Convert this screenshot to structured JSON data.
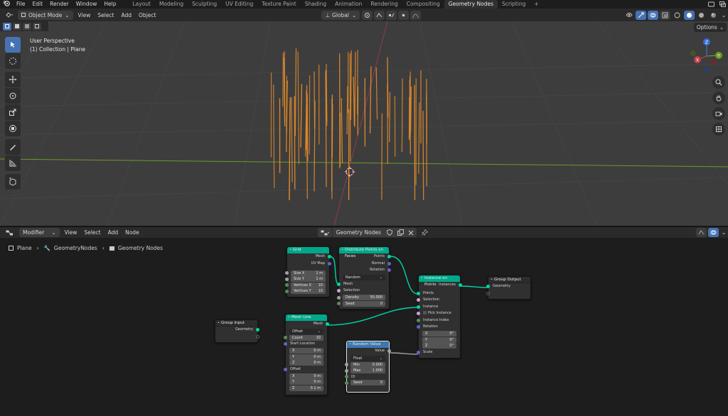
{
  "topbar": {
    "menu": [
      "File",
      "Edit",
      "Render",
      "Window",
      "Help"
    ],
    "workspaces": [
      "Layout",
      "Modeling",
      "Sculpting",
      "UV Editing",
      "Texture Paint",
      "Shading",
      "Animation",
      "Rendering",
      "Compositing",
      "Geometry Nodes",
      "Scripting"
    ],
    "active_workspace": "Geometry Nodes",
    "add_tab": "+"
  },
  "viewport_header": {
    "mode": "Object Mode",
    "menu": [
      "View",
      "Select",
      "Add",
      "Object"
    ],
    "transform_orientation": "Global"
  },
  "viewport": {
    "overlay_title": "User Perspective",
    "overlay_subtitle": "(1) Collection | Plane",
    "options_label": "Options",
    "gizmo": {
      "x": "X",
      "y": "Y",
      "z": "Z"
    }
  },
  "node_editor_header": {
    "context": "Modifier",
    "menu": [
      "View",
      "Select",
      "Add",
      "Node"
    ],
    "node_group": "Geometry Nodes"
  },
  "breadcrumb": [
    "Plane",
    "GeometryNodes",
    "Geometry Nodes"
  ],
  "nodes": {
    "grid": {
      "title": "Grid",
      "out_mesh": "Mesh",
      "out_uvmap": "UV Map",
      "fields": [
        {
          "label": "Size X",
          "value": "1 m"
        },
        {
          "label": "Size Y",
          "value": "1 m"
        },
        {
          "label": "Vertices X",
          "value": "10"
        },
        {
          "label": "Vertices Y",
          "value": "10"
        }
      ]
    },
    "distribute": {
      "title": "Distribute Points on Faces",
      "out_points": "Points",
      "out_normal": "Normal",
      "out_rotation": "Rotation",
      "mode": "Random",
      "in_mesh": "Mesh",
      "in_selection": "Selection",
      "density_label": "Density",
      "density_value": "50.000",
      "seed_label": "Seed",
      "seed_value": "0"
    },
    "instance": {
      "title": "Instance on Points",
      "out_instances": "Instances",
      "in_points": "Points",
      "in_selection": "Selection",
      "in_instance": "Instance",
      "pick_instance": "Pick Instance",
      "instance_index": "Instance Index",
      "rotation": "Rotation",
      "rot_fields": [
        {
          "label": "X",
          "value": "0°"
        },
        {
          "label": "Y",
          "value": "0°"
        },
        {
          "label": "Z",
          "value": "0°"
        }
      ],
      "scale": "Scale"
    },
    "group_output": {
      "title": "Group Output",
      "in_geometry": "Geometry"
    },
    "group_input": {
      "title": "Group Input",
      "out_geometry": "Geometry"
    },
    "mesh_line": {
      "title": "Mesh Line",
      "out_mesh": "Mesh",
      "mode": "Offset",
      "count_label": "Count",
      "count_value": "10",
      "start_location": "Start Location",
      "start_fields": [
        {
          "label": "X",
          "value": "0 m"
        },
        {
          "label": "Y",
          "value": "0 m"
        },
        {
          "label": "Z",
          "value": "0 m"
        }
      ],
      "offset": "Offset",
      "offset_fields": [
        {
          "label": "X",
          "value": "0 m"
        },
        {
          "label": "Y",
          "value": "0 m"
        },
        {
          "label": "Z",
          "value": "0.1 m"
        }
      ]
    },
    "random_value": {
      "title": "Random Value",
      "out_value": "Value",
      "type": "Float",
      "min_label": "Min",
      "min_value": "0.000",
      "max_label": "Max",
      "max_value": "1.000",
      "id_label": "ID",
      "seed_label": "Seed",
      "seed_value": "0"
    }
  },
  "colors": {
    "geometry_header": "#00a88a",
    "input_header": "#6f7fa8",
    "utility_header": "#3b77b0",
    "geometry_link": "#00d6a3",
    "instance_lines": "#e08a2c",
    "accent_blue": "#4772b3"
  }
}
